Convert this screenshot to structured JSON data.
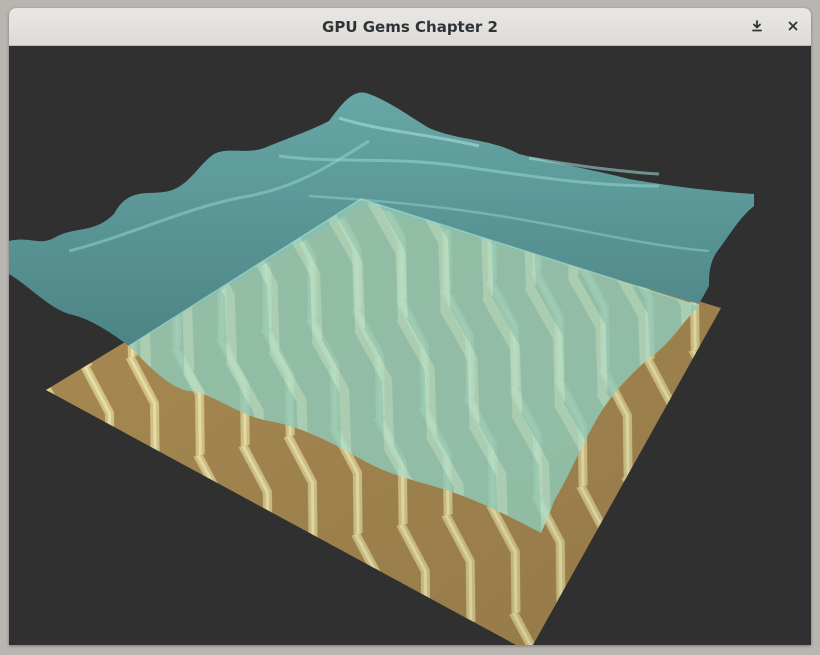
{
  "window": {
    "title": "GPU Gems Chapter 2",
    "buttons": [
      {
        "name": "download",
        "icon": "download-icon"
      },
      {
        "name": "close",
        "icon": "close-icon"
      }
    ]
  },
  "scene": {
    "background_color": "#303030",
    "water_color": "#8fd6c4",
    "water_deep_color": "#5c9a99",
    "floor_color": "#a88a52",
    "caustic_color": "#e8dc9a"
  }
}
